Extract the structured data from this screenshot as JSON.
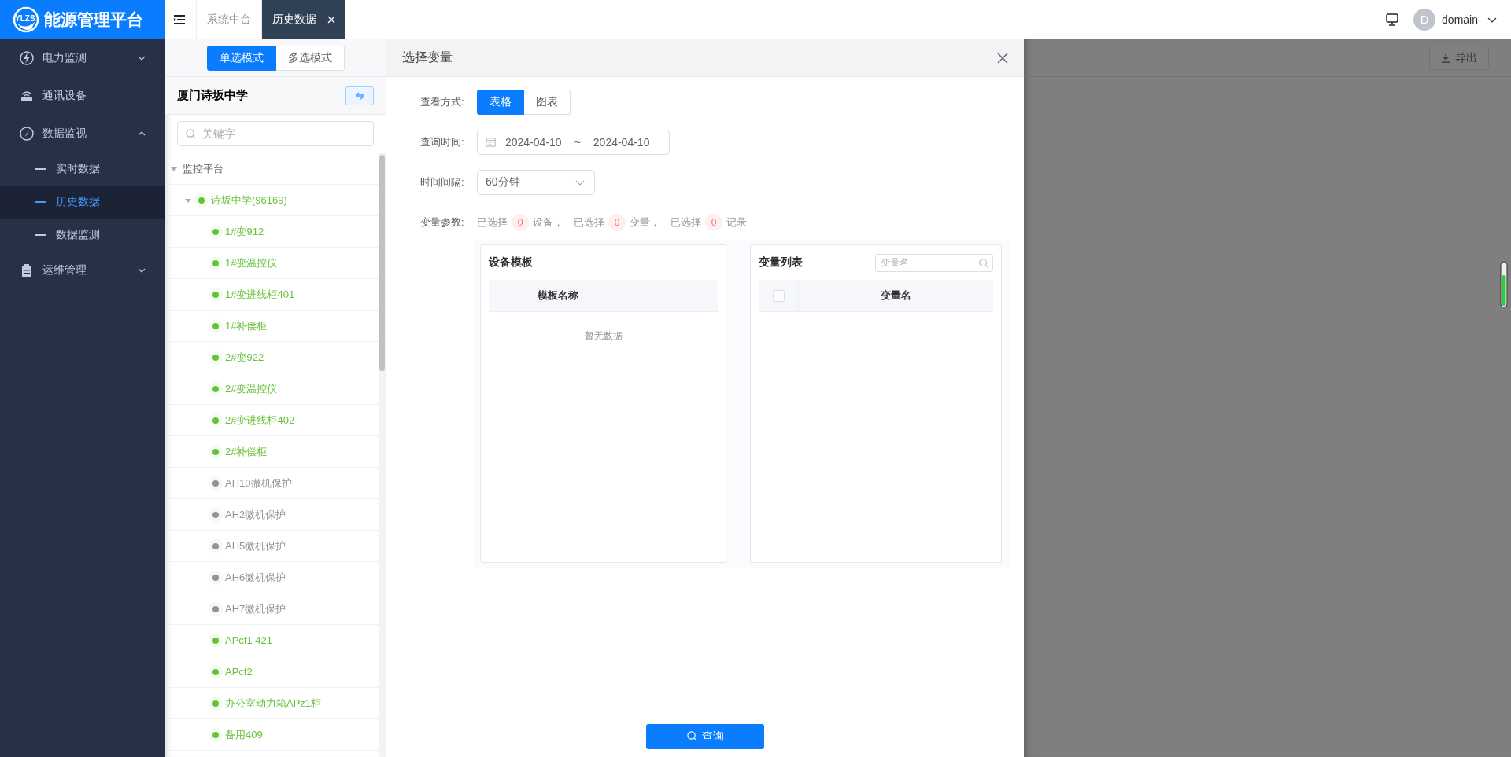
{
  "app": {
    "logo_text": "YLZS",
    "title": "能源管理平台"
  },
  "sidebar": {
    "items": [
      {
        "label": "电力监测",
        "expanded": false
      },
      {
        "label": "通讯设备"
      },
      {
        "label": "数据监视",
        "expanded": true,
        "children": [
          {
            "label": "实时数据",
            "selected": false
          },
          {
            "label": "历史数据",
            "selected": true
          },
          {
            "label": "数据监测",
            "selected": false
          }
        ]
      },
      {
        "label": "运维管理",
        "expanded": false
      }
    ]
  },
  "tabs": [
    {
      "label": "系统中台",
      "selected": false,
      "closable": false
    },
    {
      "label": "历史数据",
      "selected": true,
      "closable": true
    }
  ],
  "user": {
    "avatar_letter": "D",
    "name": "domain"
  },
  "tree_panel": {
    "modes": [
      {
        "label": "单选模式",
        "selected": true
      },
      {
        "label": "多选模式",
        "selected": false
      }
    ],
    "title": "厦门诗坂中学",
    "search": {
      "placeholder": "关键字"
    },
    "tree": [
      {
        "label": "监控平台",
        "expanded": true,
        "children": [
          {
            "label": "诗坂中学(96169)",
            "color": "#67c23a",
            "expanded": true,
            "children": [
              {
                "label": "1#变912",
                "color": "#67c23a"
              },
              {
                "label": "1#变温控仪",
                "color": "#67c23a"
              },
              {
                "label": "1#变进线柜401",
                "color": "#67c23a"
              },
              {
                "label": "1#补偿柜",
                "color": "#67c23a"
              },
              {
                "label": "2#变922",
                "color": "#67c23a"
              },
              {
                "label": "2#变温控仪",
                "color": "#67c23a"
              },
              {
                "label": "2#变进线柜402",
                "color": "#67c23a"
              },
              {
                "label": "2#补偿柜",
                "color": "#67c23a"
              },
              {
                "label": "AH10微机保护",
                "color": "#909399"
              },
              {
                "label": "AH2微机保护",
                "color": "#909399"
              },
              {
                "label": "AH5微机保护",
                "color": "#909399"
              },
              {
                "label": "AH6微机保护",
                "color": "#909399"
              },
              {
                "label": "AH7微机保护",
                "color": "#909399"
              },
              {
                "label": "APcf1 421",
                "color": "#67c23a"
              },
              {
                "label": "APcf2",
                "color": "#67c23a"
              },
              {
                "label": "办公室动力箱APz1柜",
                "color": "#67c23a"
              },
              {
                "label": "备用409",
                "color": "#67c23a"
              }
            ]
          }
        ]
      }
    ]
  },
  "dialog": {
    "title": "选择变量",
    "fields": [
      {
        "kind": "toggle",
        "label": "查看方式:",
        "options": [
          {
            "label": "表格",
            "selected": true
          },
          {
            "label": "图表",
            "selected": false
          }
        ]
      },
      {
        "kind": "daterange",
        "label": "查询时间:",
        "start": "2024-04-10",
        "separator": "~",
        "end": "2024-04-10"
      },
      {
        "kind": "select",
        "label": "时间间隔:",
        "value": "60分钟"
      },
      {
        "kind": "summary",
        "label": "变量参数:",
        "parts": [
          {
            "prefix": "已选择",
            "count": "0",
            "suffix": "设备，"
          },
          {
            "prefix": "已选择",
            "count": "0",
            "suffix": "变量，"
          },
          {
            "prefix": "已选择",
            "count": "0",
            "suffix": "记录"
          }
        ]
      }
    ],
    "template_panel": {
      "title": "设备模板",
      "columns": [
        "模板名称"
      ],
      "empty_text": "暂无数据"
    },
    "variable_panel": {
      "title": "变量列表",
      "search": {
        "placeholder": "变量名"
      },
      "select_all_checked": false,
      "columns": [
        "变量名"
      ]
    },
    "query_button": "查询"
  },
  "background": {
    "export_button": "导出"
  }
}
